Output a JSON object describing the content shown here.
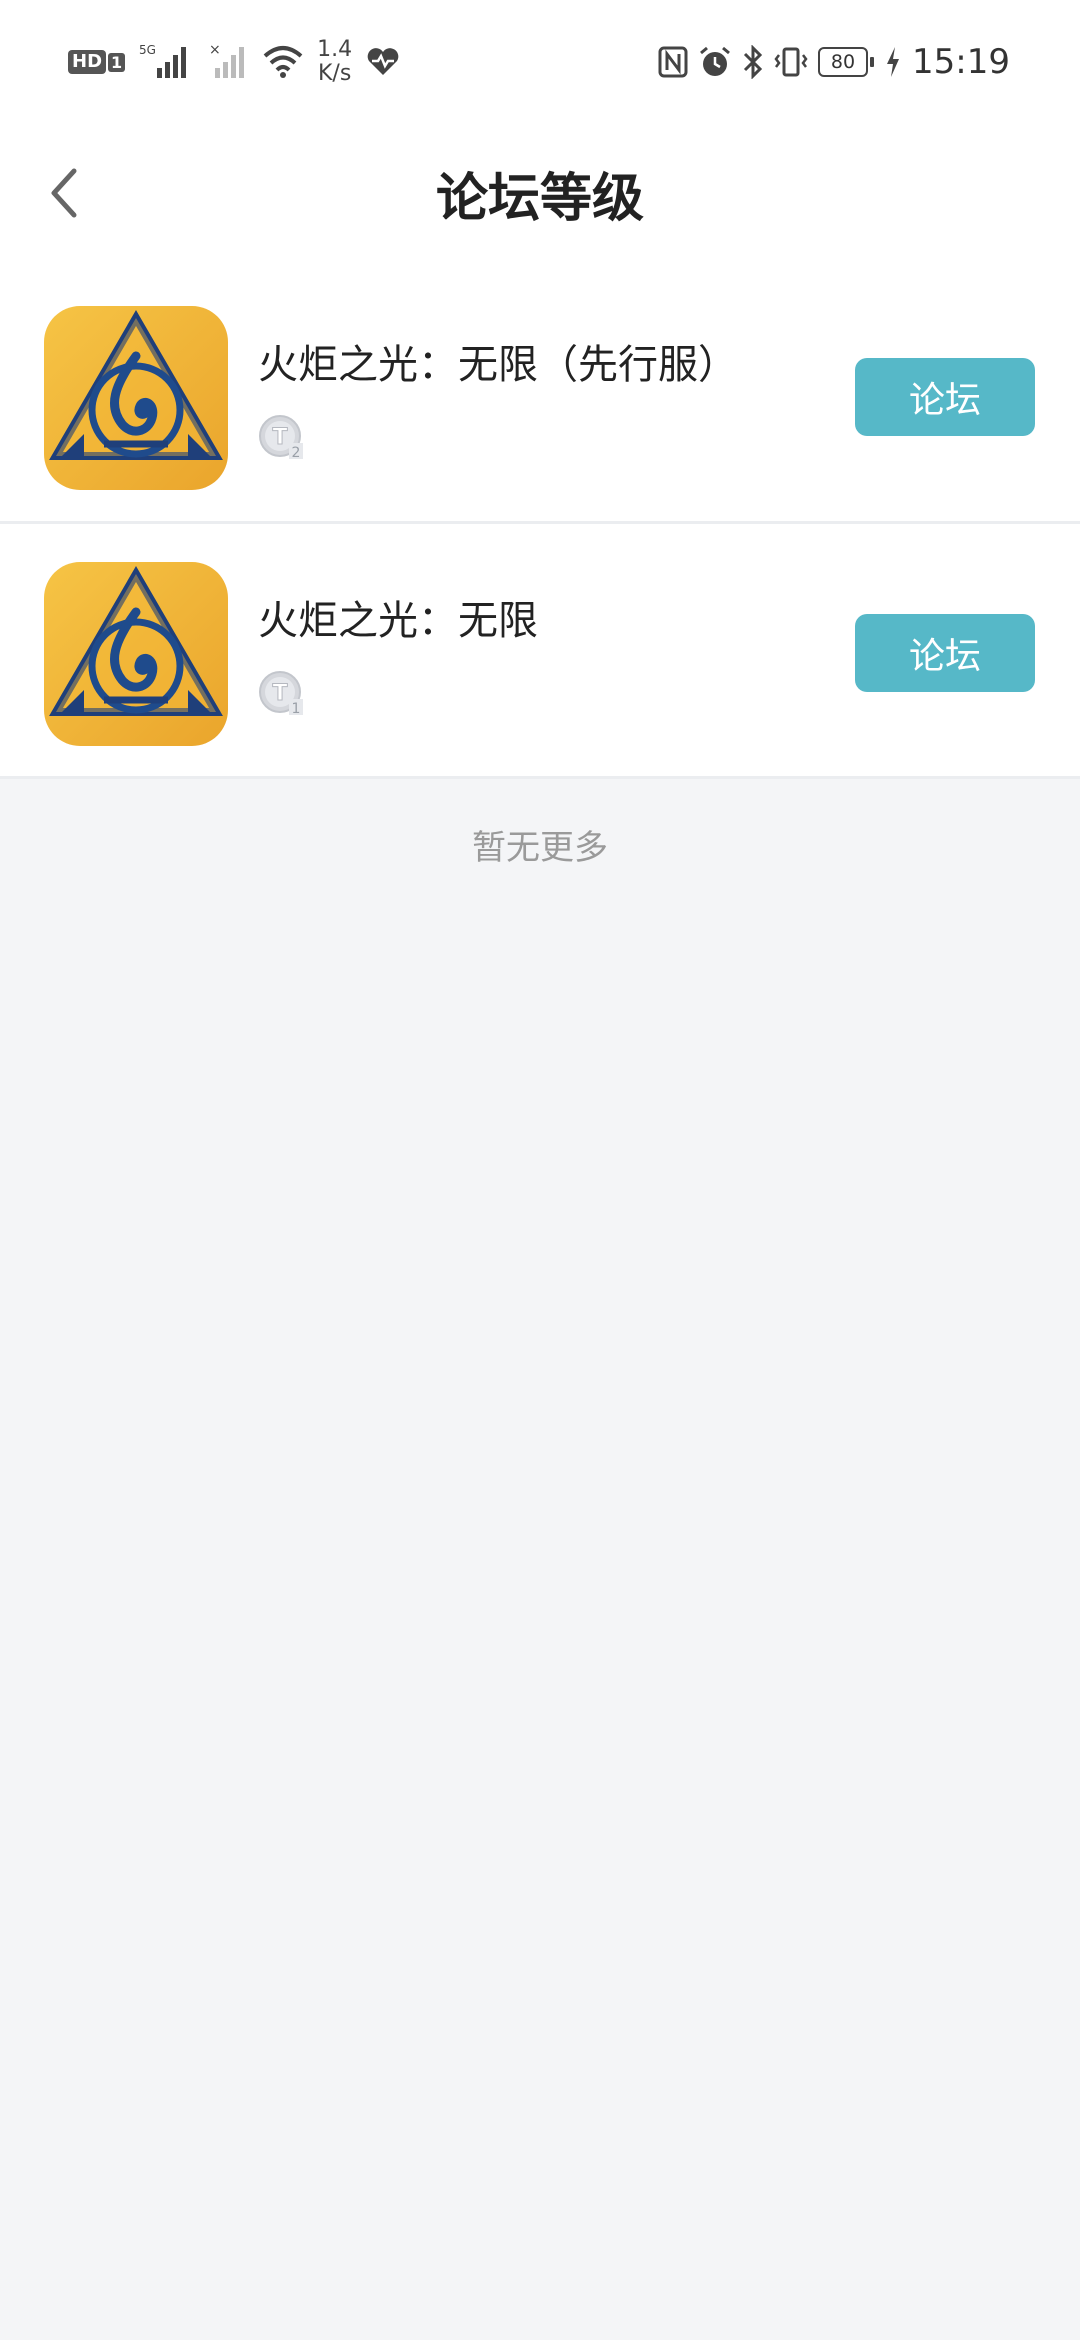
{
  "status_bar": {
    "hd_label": "HD",
    "hd_sim": "1",
    "network": "5G",
    "speed_value": "1.4",
    "speed_unit": "K/s",
    "battery": "80",
    "time": "15:19"
  },
  "header": {
    "title": "论坛等级"
  },
  "forums": [
    {
      "name": "火炬之光：无限（先行服）",
      "level": "2",
      "button_label": "论坛"
    },
    {
      "name": "火炬之光：无限",
      "level": "1",
      "button_label": "论坛"
    }
  ],
  "footer_text": "暂无更多",
  "colors": {
    "accent_button": "#56b8c8",
    "background": "#f4f5f7",
    "icon_yellow": "#f2b638",
    "icon_blue": "#1f4b8c"
  }
}
